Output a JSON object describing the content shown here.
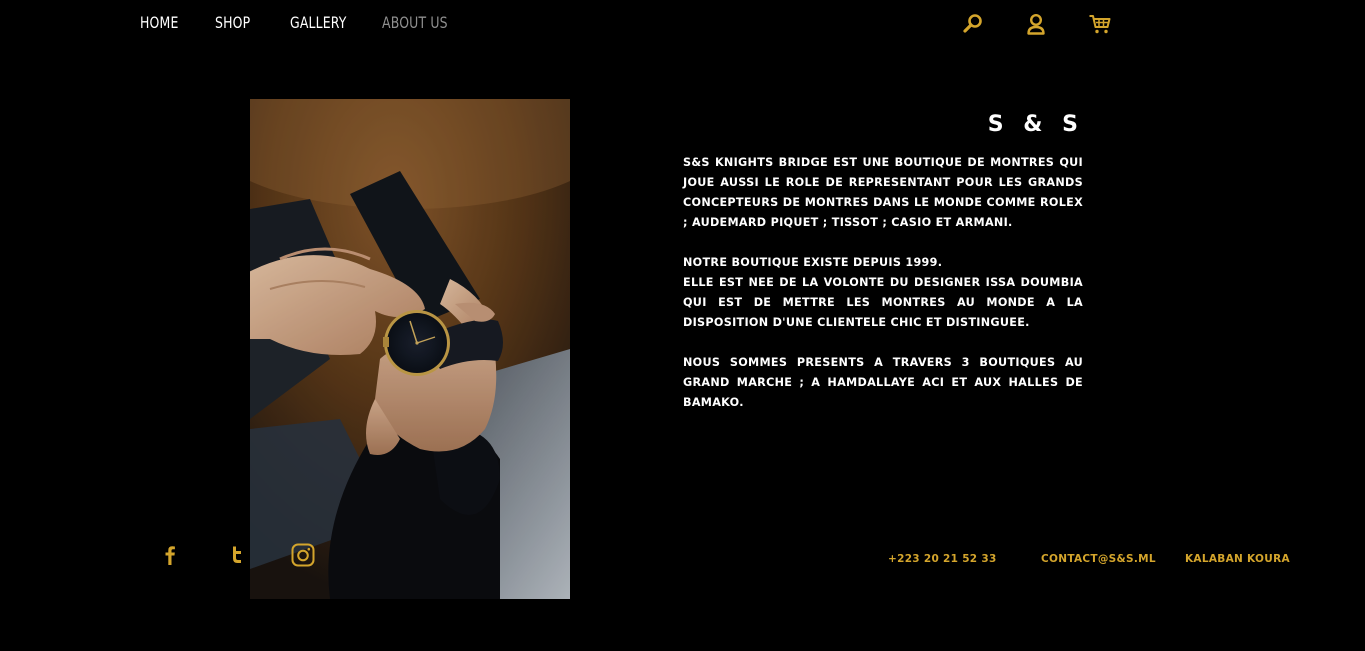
{
  "nav": {
    "items": [
      {
        "label": "HOME"
      },
      {
        "label": "SHOP"
      },
      {
        "label": "GALLERY"
      },
      {
        "label": "ABOUT US"
      }
    ],
    "icons": [
      "search-icon",
      "user-icon",
      "cart-icon"
    ]
  },
  "colors": {
    "background": "#000000",
    "accent": "#d4a52c",
    "text": "#ffffff",
    "nav_active": "#8f8f8f"
  },
  "about": {
    "brand": "S & S",
    "paragraph1": "S&S KNIGHTS BRIDGE EST UNE BOUTIQUE DE MONTRES QUI JOUE AUSSI LE ROLE DE REPRESENTANT POUR LES GRANDS CONCEPTEURS DE MONTRES DANS LE MONDE COMME ROLEX ; AUDEMARD PIQUET ; TISSOT ; CASIO ET ARMANI.",
    "paragraph2_line1": "NOTRE BOUTIQUE EXISTE DEPUIS 1999.",
    "paragraph2_line2": "ELLE EST NEE DE LA VOLONTE DU DESIGNER ISSA DOUMBIA QUI EST DE METTRE LES MONTRES AU MONDE A LA DISPOSITION D'UNE CLIENTELE CHIC ET DISTINGUEE.",
    "paragraph3": "NOUS SOMMES PRESENTS A TRAVERS 3 BOUTIQUES AU GRAND MARCHE ; A HAMDALLAYE ACI ET AUX HALLES DE BAMAKO."
  },
  "social": [
    "facebook-icon",
    "twitter-icon",
    "instagram-icon"
  ],
  "footer": {
    "phone": "+223 20 21 52 33",
    "email": "CONTACT@S&S.ML",
    "address": "KALABAN KOURA"
  }
}
